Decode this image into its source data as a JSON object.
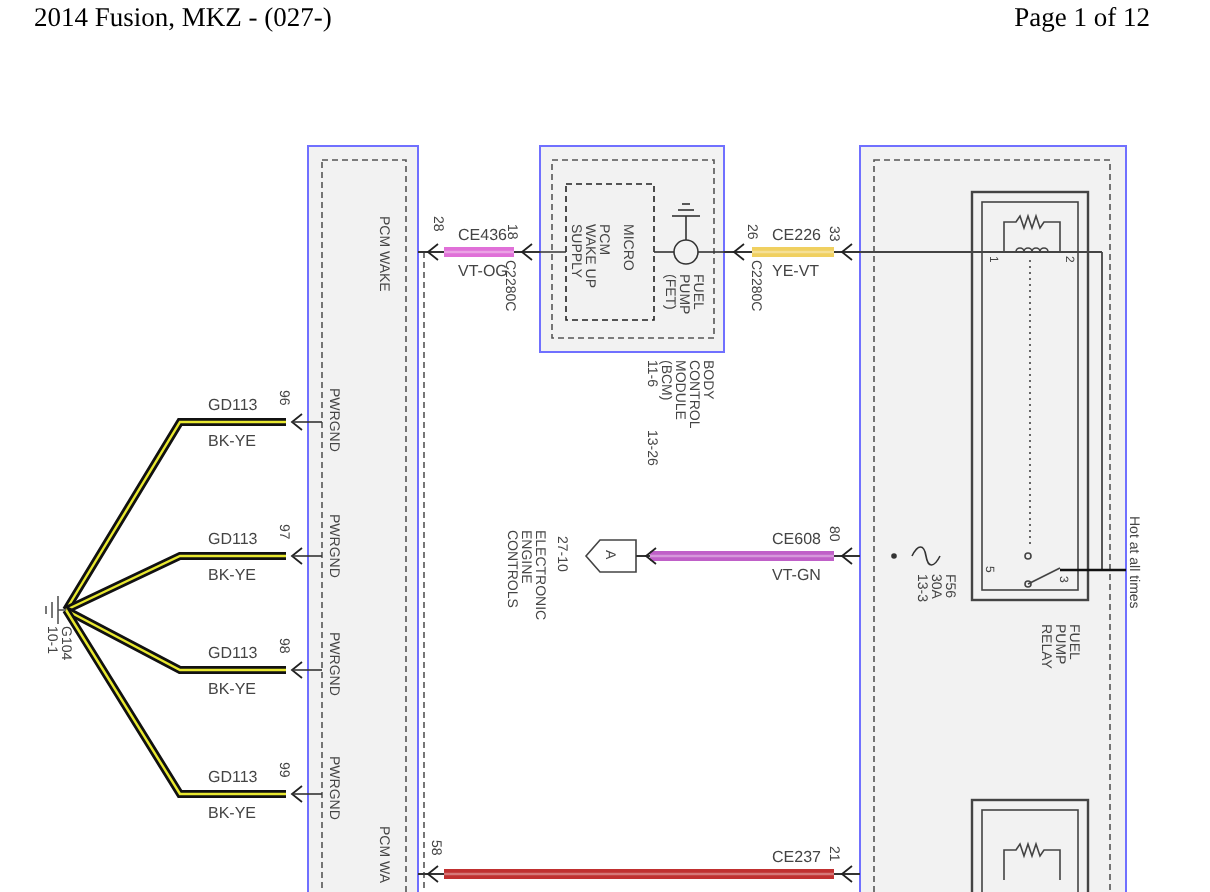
{
  "header": {
    "title": "2014 Fusion, MKZ - (027-)",
    "page": "Page 1 of 12"
  },
  "pcm": {
    "pins": [
      "PCM WAKE",
      "PWRGND",
      "PWRGND",
      "PWRGND",
      "PWRGND",
      "PCM WA"
    ]
  },
  "bcm": {
    "micro": "MICRO",
    "supply": [
      "PCM",
      "WAKE UP",
      "SUPPLY"
    ],
    "fet": [
      "FUEL",
      "PUMP",
      "(FET)"
    ],
    "name": [
      "BODY",
      "CONTROL",
      "MODULE",
      "(BCM)",
      "11-6"
    ],
    "ref": "13-26"
  },
  "ground": {
    "name": [
      "G104",
      "10-1"
    ]
  },
  "ground_wires": [
    {
      "circuit": "GD113",
      "code": "BK-YE",
      "pin": "96",
      "color": "#e8e830"
    },
    {
      "circuit": "GD113",
      "code": "BK-YE",
      "pin": "97",
      "color": "#e8e830"
    },
    {
      "circuit": "GD113",
      "code": "BK-YE",
      "pin": "98",
      "color": "#e8e830"
    },
    {
      "circuit": "GD113",
      "code": "BK-YE",
      "pin": "99",
      "color": "#e8e830"
    }
  ],
  "wires": [
    {
      "circuit": "CE436",
      "code": "VT-OG",
      "pins": [
        "28",
        "18"
      ],
      "connector": "C2280C",
      "color": "#e070d8"
    },
    {
      "circuit": "CE226",
      "code": "YE-VT",
      "pins": [
        "26",
        "33"
      ],
      "connector": "C2280C",
      "color": "#f0d060"
    },
    {
      "circuit": "CE608",
      "code": "VT-GN",
      "pins": [
        "80"
      ],
      "color": "#c060c8"
    },
    {
      "circuit": "CE237",
      "pins": [
        "58",
        "21"
      ],
      "color": "#c03030"
    }
  ],
  "engine_controls": {
    "connector": "A",
    "ref": "27-10",
    "name": [
      "ELECTRONIC",
      "ENGINE",
      "CONTROLS"
    ]
  },
  "fuse": [
    "F56",
    "30A",
    "13-3"
  ],
  "relay": {
    "name": [
      "FUEL",
      "PUMP",
      "RELAY"
    ],
    "pins": [
      "1",
      "2",
      "5",
      "3"
    ]
  },
  "power_note": "Hot at all times"
}
